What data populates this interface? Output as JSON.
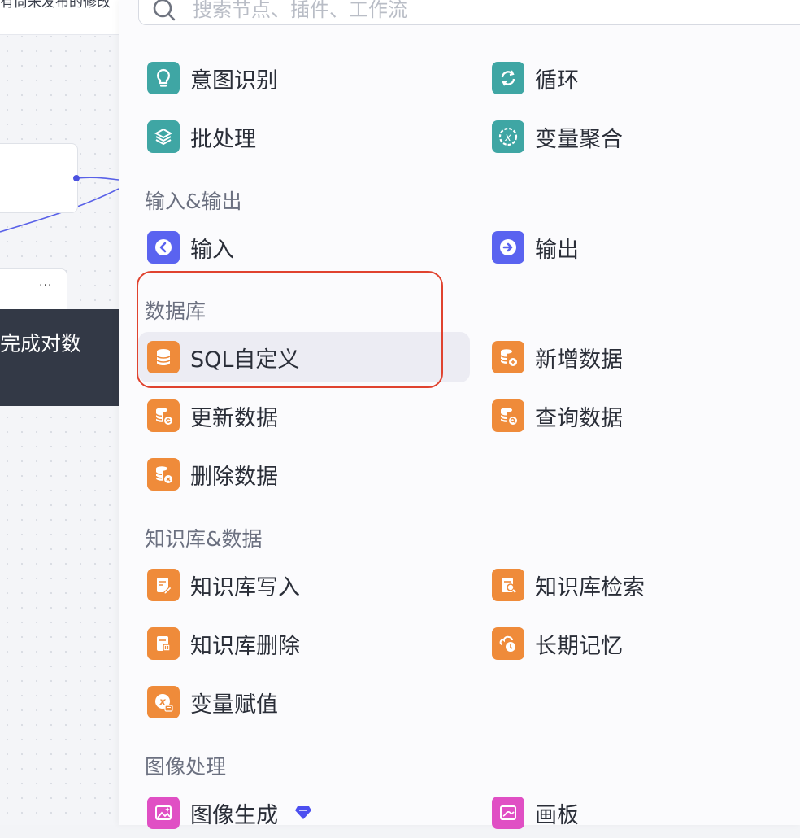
{
  "canvas": {
    "top_strip_text": "有尚未发布的修改",
    "tooltip_text": "完成对数",
    "more_label": "···"
  },
  "search": {
    "placeholder": "搜索节点、插件、工作流"
  },
  "sections": {
    "io_title": "输入&输出",
    "db_title": "数据库",
    "kb_title": "知识库&数据",
    "image_title": "图像处理"
  },
  "items": {
    "intent": "意图识别",
    "loop": "循环",
    "batch": "批处理",
    "var_agg": "变量聚合",
    "input": "输入",
    "output": "输出",
    "sql": "SQL自定义",
    "add_data": "新增数据",
    "update_data": "更新数据",
    "query_data": "查询数据",
    "delete_data": "删除数据",
    "kb_write": "知识库写入",
    "kb_search": "知识库检索",
    "kb_delete": "知识库删除",
    "long_memory": "长期记忆",
    "var_assign": "变量赋值",
    "image_gen": "图像生成",
    "canvas_board": "画板"
  },
  "colors": {
    "teal": "#3fa6a4",
    "blue": "#5a63f0",
    "orange": "#ef8b3a",
    "pink": "#e04fc4",
    "highlight": "#e0432f",
    "premium": "#4c4ff0"
  },
  "icons": {
    "intent": "lightbulb-icon",
    "loop": "loop-icon",
    "batch": "layers-icon",
    "var_agg": "variable-aggregate-icon",
    "input": "input-arrow-icon",
    "output": "output-arrow-icon",
    "database": "database-icon",
    "kb": "knowledge-doc-icon",
    "image": "image-icon",
    "premium": "diamond-icon"
  },
  "selected_item": "SQL自定义"
}
